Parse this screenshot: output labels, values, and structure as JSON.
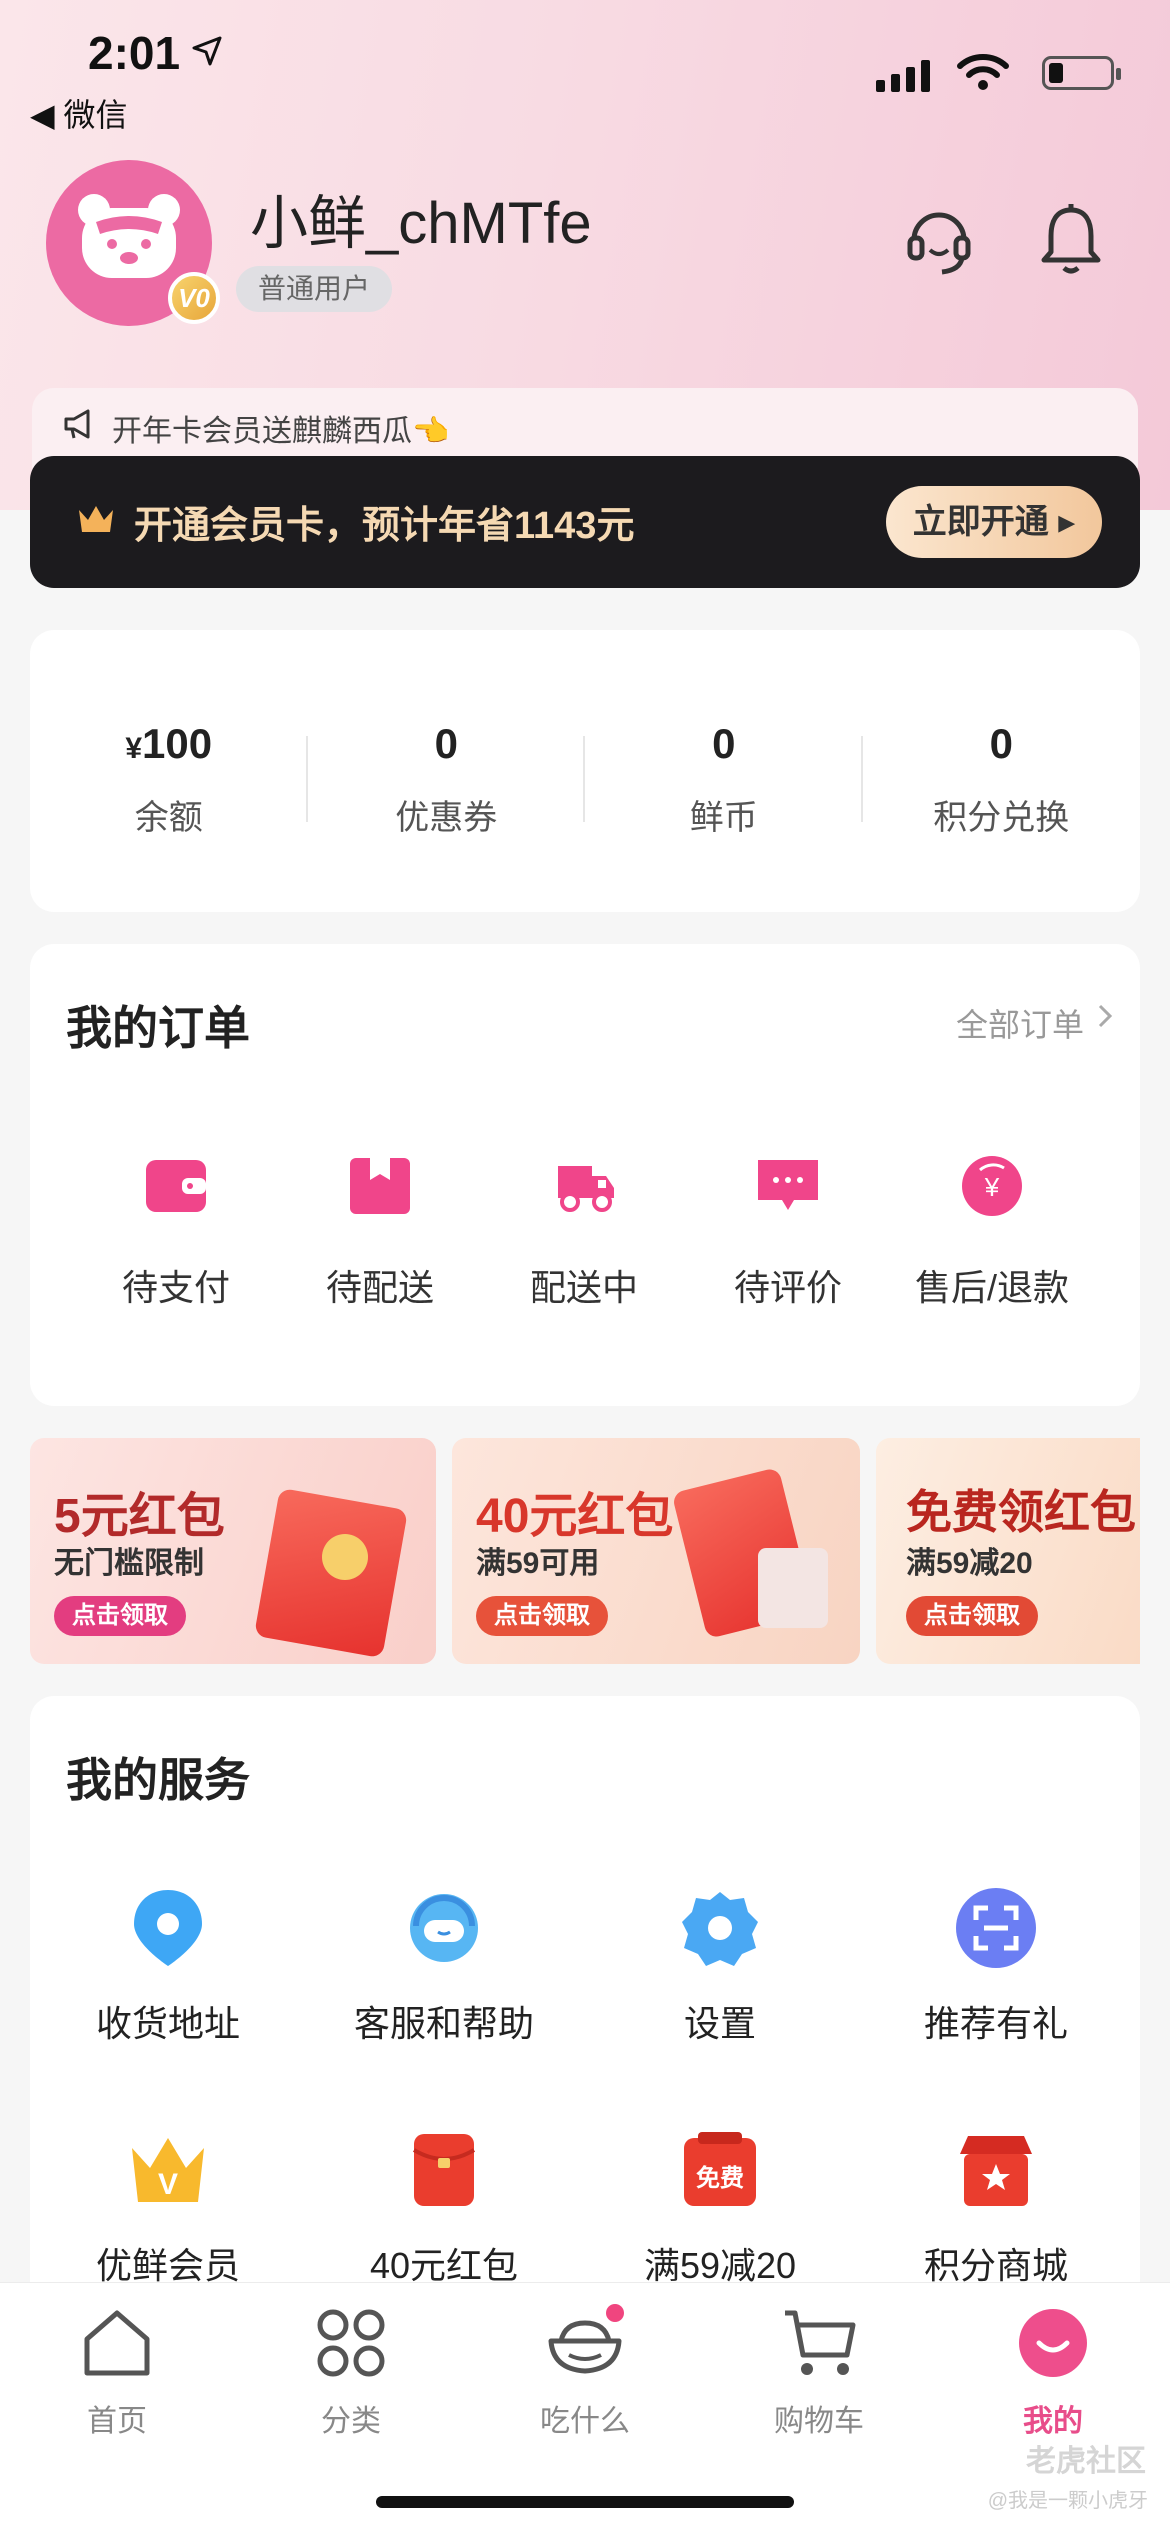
{
  "status_bar": {
    "time": "2:01",
    "back_app": "◀ 微信"
  },
  "profile": {
    "username": "小鲜_chMTfe",
    "user_level": "普通用户",
    "badge": "V0"
  },
  "promo": {
    "notice": "开年卡会员送麒麟西瓜👈",
    "vip_text": "开通会员卡，预计年省1143元",
    "vip_button": "立即开通"
  },
  "stats": [
    {
      "prefix": "¥",
      "value": "100",
      "label": "余额"
    },
    {
      "prefix": "",
      "value": "0",
      "label": "优惠券"
    },
    {
      "prefix": "",
      "value": "0",
      "label": "鲜币"
    },
    {
      "prefix": "",
      "value": "0",
      "label": "积分兑换"
    }
  ],
  "orders": {
    "title": "我的订单",
    "all_link": "全部订单",
    "items": [
      {
        "label": "待支付",
        "icon": "wallet-icon"
      },
      {
        "label": "待配送",
        "icon": "package-icon"
      },
      {
        "label": "配送中",
        "icon": "delivery-truck-icon"
      },
      {
        "label": "待评价",
        "icon": "comment-icon"
      },
      {
        "label": "售后/退款",
        "icon": "refund-icon"
      }
    ]
  },
  "banners": [
    {
      "title": "5元红包",
      "subtitle": "无门槛限制",
      "button": "点击领取"
    },
    {
      "title": "40元红包",
      "subtitle": "满59可用",
      "button": "点击领取"
    },
    {
      "title": "免费领红包",
      "subtitle": "满59减20",
      "button": "点击领取"
    }
  ],
  "services": {
    "title": "我的服务",
    "items": [
      {
        "label": "收货地址",
        "icon": "location-pin-icon"
      },
      {
        "label": "客服和帮助",
        "icon": "customer-service-icon"
      },
      {
        "label": "设置",
        "icon": "settings-gear-icon"
      },
      {
        "label": "推荐有礼",
        "icon": "scan-icon"
      },
      {
        "label": "优鲜会员",
        "icon": "crown-icon"
      },
      {
        "label": "40元红包",
        "icon": "red-packet-icon"
      },
      {
        "label": "满59减20",
        "icon": "free-coupon-icon"
      },
      {
        "label": "积分商城",
        "icon": "store-icon"
      }
    ],
    "coupon_badge_text": "免费"
  },
  "tabbar": [
    {
      "label": "首页",
      "icon": "home-icon",
      "active": false
    },
    {
      "label": "分类",
      "icon": "category-grid-icon",
      "active": false
    },
    {
      "label": "吃什么",
      "icon": "food-bowl-icon",
      "active": false
    },
    {
      "label": "购物车",
      "icon": "cart-icon",
      "active": false
    },
    {
      "label": "我的",
      "icon": "profile-smile-icon",
      "active": true
    }
  ],
  "watermark": {
    "site": "老虎社区",
    "author": "@我是一颗小虎牙"
  },
  "colors": {
    "accent": "#e84d8a",
    "vip_bar": "#1c1b1e",
    "vip_gold": "#f5d9b3"
  }
}
